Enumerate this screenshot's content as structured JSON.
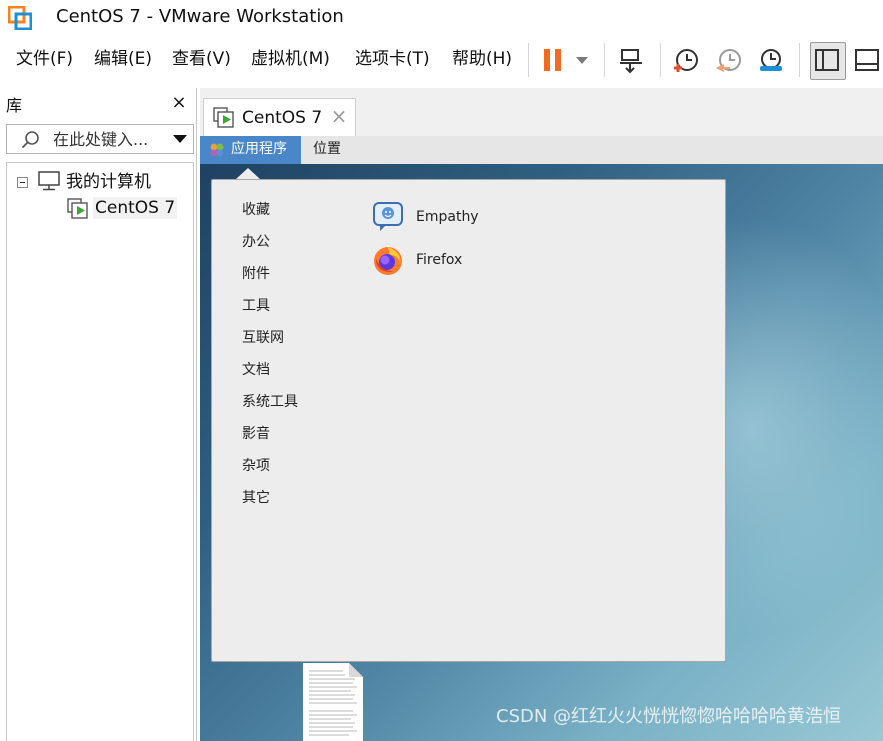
{
  "window": {
    "title": "CentOS 7 - VMware Workstation"
  },
  "menu": {
    "items": [
      "文件(F)",
      "编辑(E)",
      "查看(V)",
      "虚拟机(M)",
      "选项卡(T)",
      "帮助(H)"
    ]
  },
  "toolbar": {
    "icons": [
      "pause-icon",
      "dropdown-arrow-icon",
      "send-ctrl-alt-del-icon",
      "snapshot-icon",
      "revert-snapshot-icon",
      "snapshot-manager-icon",
      "library-layout-icon",
      "console-layout-icon"
    ],
    "pause_color": "#f26b21"
  },
  "library": {
    "title": "库",
    "close_glyph": "×",
    "search_placeholder": "在此处键入...",
    "tree": {
      "root_label": "我的计算机",
      "vm_label": "CentOS 7"
    }
  },
  "tab": {
    "label": "CentOS 7",
    "close_glyph": "×"
  },
  "guest": {
    "panel": {
      "apps_label": "应用程序",
      "places_label": "位置",
      "accent": "#4a87c9"
    },
    "categories": [
      "收藏",
      "办公",
      "附件",
      "工具",
      "互联网",
      "文档",
      "系统工具",
      "影音",
      "杂项",
      "其它"
    ],
    "apps": [
      {
        "label": "Empathy",
        "icon": "empathy-chat-icon"
      },
      {
        "label": "Firefox",
        "icon": "firefox-icon"
      }
    ]
  },
  "watermark": "CSDN @红红火火恍恍惚惚哈哈哈哈黄浩恒"
}
